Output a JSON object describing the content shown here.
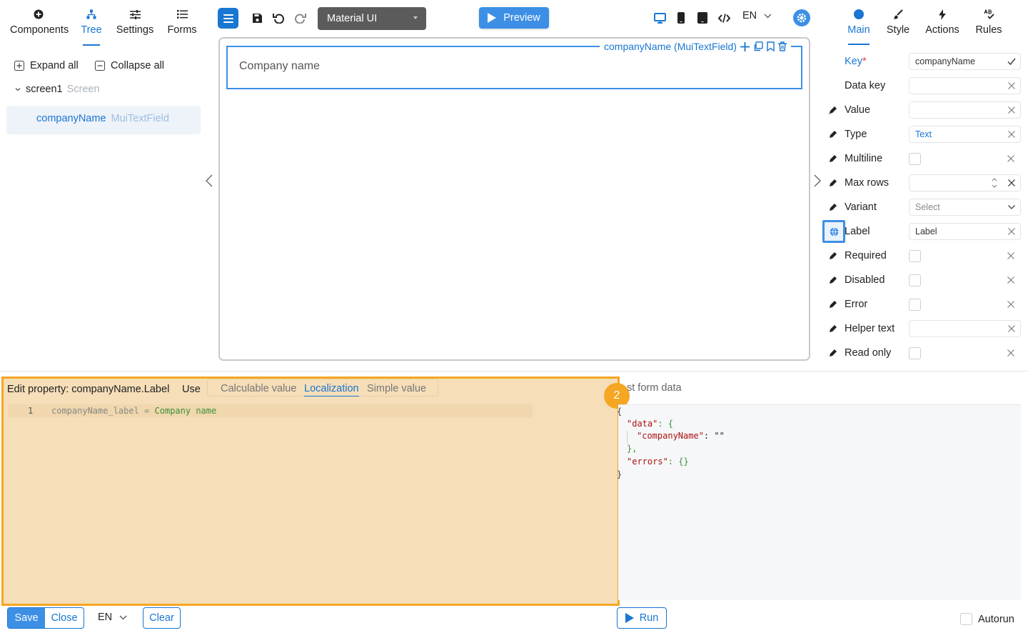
{
  "left_tabs": [
    {
      "label": "Components",
      "icon": "plus-circle-icon"
    },
    {
      "label": "Tree",
      "icon": "tree-icon"
    },
    {
      "label": "Settings",
      "icon": "sliders-icon"
    },
    {
      "label": "Forms",
      "icon": "list-icon"
    }
  ],
  "tree": {
    "expand_all": "Expand all",
    "collapse_all": "Collapse all",
    "screen_name": "screen1",
    "screen_type": "Screen",
    "node_name": "companyName",
    "node_type": "MuiTextField"
  },
  "toolbar": {
    "ui_library": "Material UI",
    "preview": "Preview",
    "language": "EN"
  },
  "canvas": {
    "component_caption": "companyName (MuiTextField)",
    "field_label": "Company name"
  },
  "right_tabs": [
    {
      "label": "Main",
      "icon": "circle-icon"
    },
    {
      "label": "Style",
      "icon": "brush-icon"
    },
    {
      "label": "Actions",
      "icon": "bolt-icon"
    },
    {
      "label": "Rules",
      "icon": "spellcheck-icon"
    }
  ],
  "properties": {
    "key_label": "Key",
    "key_required": "*",
    "key_value": "companyName",
    "data_key": "Data key",
    "value": "Value",
    "type_label": "Type",
    "type_value": "Text",
    "multiline": "Multiline",
    "max_rows": "Max rows",
    "variant": "Variant",
    "variant_placeholder": "Select",
    "label_label": "Label",
    "label_value": "Label",
    "required": "Required",
    "disabled": "Disabled",
    "error": "Error",
    "helper_text": "Helper text",
    "read_only": "Read only"
  },
  "editor": {
    "title": "Edit property: companyName.Label",
    "use": "Use",
    "modes": [
      "Calculable value",
      "Localization",
      "Simple value"
    ],
    "active_mode": "Localization",
    "line_number": "1",
    "code_key": "companyName_label",
    "code_eq": " = ",
    "code_value": "Company name",
    "step_badge": "2"
  },
  "form_data": {
    "title": "st form data",
    "line1": "{",
    "line2_key": "\"data\"",
    "line2_rest": ": {",
    "line3_key": "\"companyName\"",
    "line3_rest": ": \"\"",
    "line4": "},",
    "line5_key": "\"errors\"",
    "line5_rest": ": {}",
    "line6": "}"
  },
  "footer": {
    "save": "Save",
    "close": "Close",
    "language": "EN",
    "clear": "Clear",
    "run": "Run",
    "autorun": "Autorun"
  },
  "colors": {
    "accent": "#1976d2",
    "highlight": "#f5a623",
    "highlight_fill": "#f5deb8"
  }
}
